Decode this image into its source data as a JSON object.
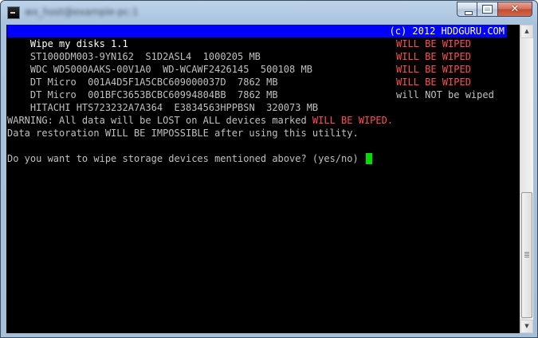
{
  "window": {
    "title": "wx_host@example-pc:1"
  },
  "header": {
    "left": "Wipe my disks 1.1",
    "right": "(c) 2012 HDDGURU.COM"
  },
  "devices": [
    {
      "name": "ST1000DM003-9YN162  S1D2ASL4  1000205 MB",
      "status": "WILL BE WIPED",
      "wiped": true
    },
    {
      "name": "WDC WD5000AAKS-00V1A0  WD-WCAWF2426145  500108 MB",
      "status": "WILL BE WIPED",
      "wiped": true
    },
    {
      "name": "DT Micro  001A4D5F1A5CBC609000037D  7862 MB",
      "status": "WILL BE WIPED",
      "wiped": true
    },
    {
      "name": "DT Micro  001BFC3653BCBC60994804BB  7862 MB",
      "status": "WILL BE WIPED",
      "wiped": true
    },
    {
      "name": "HITACHI HTS723232A7A364  E3834563HPPBSN  320073 MB",
      "status": "will NOT be wiped",
      "wiped": false
    }
  ],
  "warning": {
    "prefix": "WARNING: All data will be LOST on ALL devices marked ",
    "highlight": "WILL BE WIPED",
    "suffix": ".",
    "line2": "Data restoration WILL BE IMPOSSIBLE after using this utility."
  },
  "prompt": "Do you want to wipe storage devices mentioned above? (yes/no) ",
  "colors": {
    "header_bg": "#0000ff",
    "wiped_red": "#ff5050",
    "cursor_green": "#00e000",
    "console_bg": "#000000",
    "console_text": "#c0c0c0"
  },
  "icons": {
    "app": "console-icon",
    "minimize": "minimize-icon",
    "maximize": "maximize-icon",
    "close": "close-icon"
  }
}
